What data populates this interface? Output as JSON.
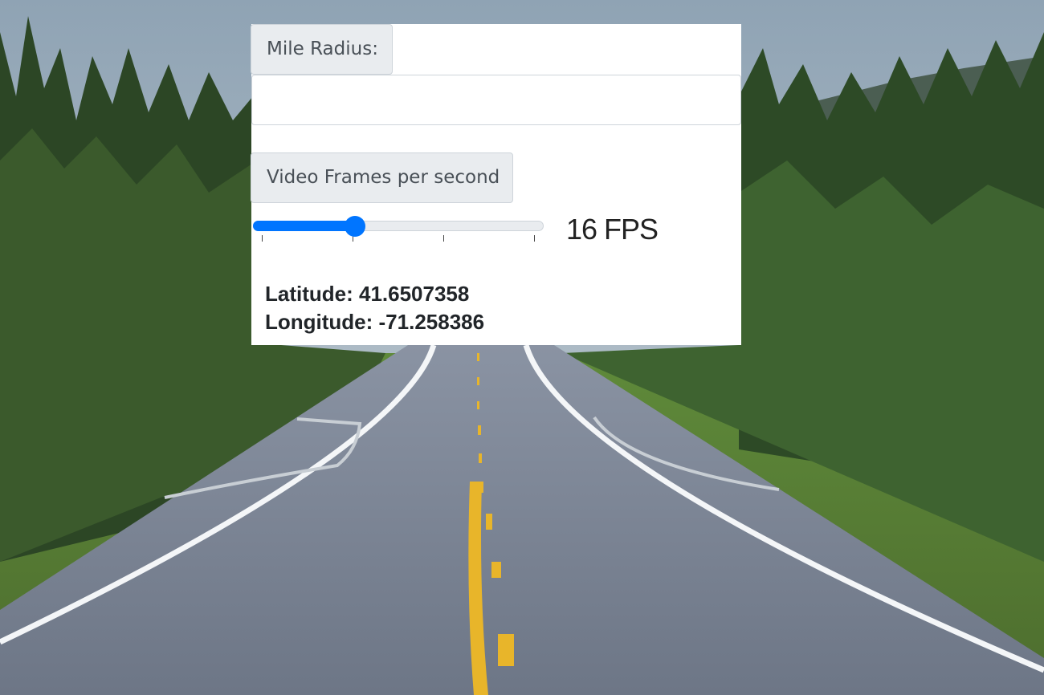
{
  "background": {
    "description_icon": "road-through-forest-photo",
    "colors": {
      "sky": "#a9b9c4",
      "forest": "#2f4a26",
      "road": "#7a8493",
      "center_line": "#e8b52a",
      "edge_line": "#f4f6f8"
    }
  },
  "form": {
    "radius_label": "Mile Radius:",
    "radius_value": "",
    "radius_placeholder": "",
    "fps_label": "Video Frames per second",
    "fps_slider_fraction": 0.34,
    "fps_display": "16 FPS"
  },
  "location": {
    "latitude_text": "Latitude: 41.6507358",
    "longitude_text": "Longitude: -71.258386"
  },
  "accent_color": "#0075ff"
}
